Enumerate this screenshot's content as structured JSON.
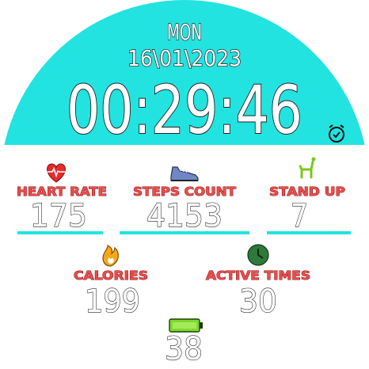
{
  "header": {
    "day": "MON",
    "date": "16\\01\\2023",
    "time": "00:29:46"
  },
  "alarm": {
    "icon": "alarm-clock-icon"
  },
  "stats": {
    "heart_rate": {
      "label": "HEART RATE",
      "value": "175",
      "icon": "heart-rate-icon"
    },
    "steps": {
      "label": "STEPS COUNT",
      "value": "4153",
      "icon": "sneaker-icon"
    },
    "stand_up": {
      "label": "STAND UP",
      "value": "7",
      "icon": "chair-icon"
    },
    "calories": {
      "label": "CALORIES",
      "value": "199",
      "icon": "flame-icon"
    },
    "active": {
      "label": "ACTIVE TIMES",
      "value": "30",
      "icon": "clock-icon"
    }
  },
  "battery": {
    "value": "38",
    "icon": "battery-icon"
  },
  "colors": {
    "accent": "#22e3e0",
    "label": "#f04a4a"
  }
}
